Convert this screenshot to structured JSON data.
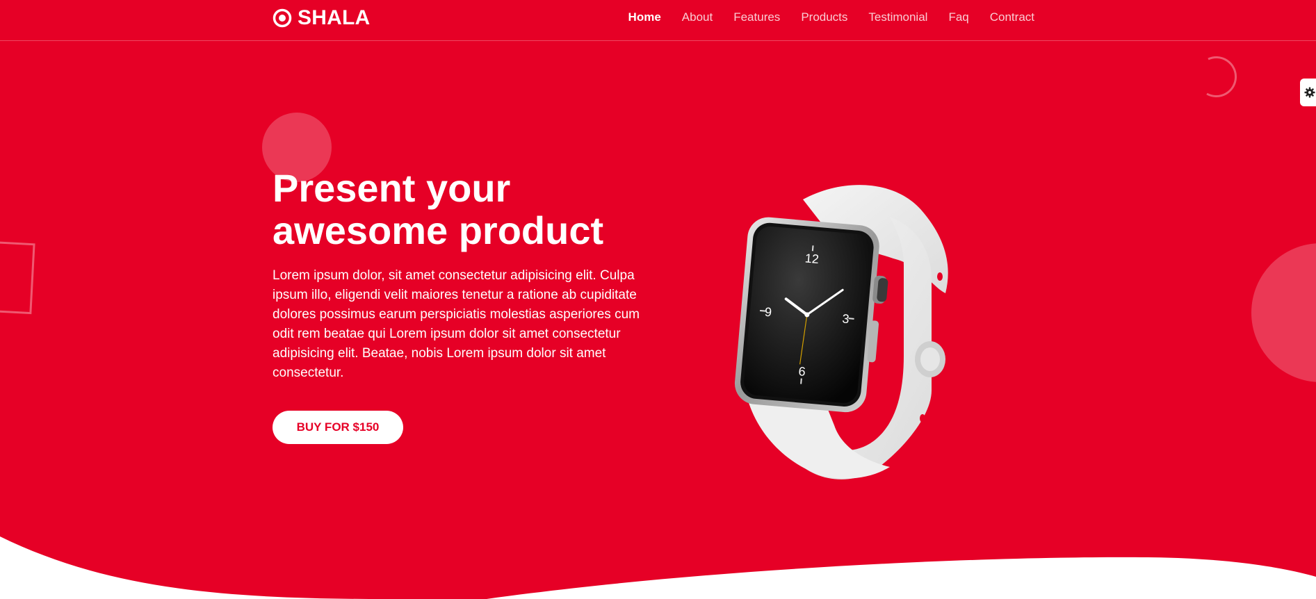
{
  "brand": {
    "name": "SHALA",
    "icon": "target-icon"
  },
  "nav": {
    "items": [
      {
        "label": "Home",
        "active": true
      },
      {
        "label": "About",
        "active": false
      },
      {
        "label": "Features",
        "active": false
      },
      {
        "label": "Products",
        "active": false
      },
      {
        "label": "Testimonial",
        "active": false
      },
      {
        "label": "Faq",
        "active": false
      },
      {
        "label": "Contract",
        "active": false
      }
    ]
  },
  "hero": {
    "title": "Present your awesome product",
    "description": "Lorem ipsum dolor, sit amet consectetur adipisicing elit. Culpa ipsum illo, eligendi velit maiores tenetur a ratione ab cupiditate dolores possimus earum perspiciatis molestias asperiores cum odit rem beatae qui Lorem ipsum dolor sit amet consectetur adipisicing elit. Beatae, nobis Lorem ipsum dolor sit amet consectetur.",
    "button_label": "BUY FOR $150",
    "image": "smartwatch-image"
  },
  "watch_face": {
    "numbers": [
      "12",
      "3",
      "6",
      "9"
    ]
  },
  "settings": {
    "icon": "gear-icon"
  },
  "colors": {
    "primary": "#e60026",
    "white": "#ffffff"
  }
}
